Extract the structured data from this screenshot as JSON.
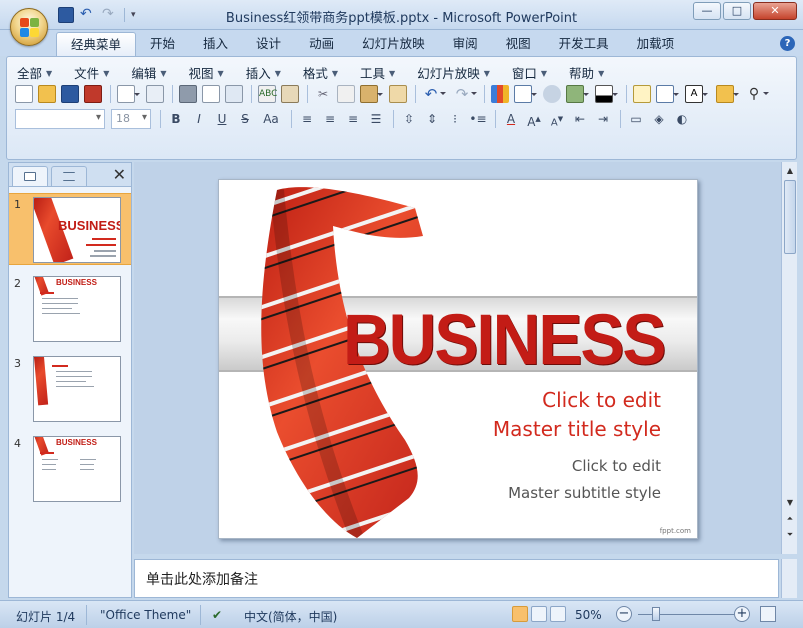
{
  "window": {
    "title": "Business红领带商务ppt模板.pptx - Microsoft PowerPoint",
    "controls": {
      "minimize": "—",
      "maximize": "□",
      "close": "✕"
    }
  },
  "ribbon_tabs": [
    "经典菜单",
    "开始",
    "插入",
    "设计",
    "动画",
    "幻灯片放映",
    "审阅",
    "视图",
    "开发工具",
    "加载项"
  ],
  "classic_menus": [
    "全部",
    "文件",
    "编辑",
    "视图",
    "插入",
    "格式",
    "工具",
    "幻灯片放映",
    "窗口",
    "帮助"
  ],
  "toolbar": {
    "font_name": "",
    "font_size": "18",
    "bold": "B",
    "italic": "I",
    "underline": "U",
    "strike": "S",
    "case": "Aa",
    "text_box": "A"
  },
  "slide_thumbnails": [
    {
      "number": "1",
      "selected": true
    },
    {
      "number": "2",
      "selected": false
    },
    {
      "number": "3",
      "selected": false
    },
    {
      "number": "4",
      "selected": false
    }
  ],
  "slide": {
    "banner_word": "BUSINESS",
    "title_line1": "Click to edit",
    "title_line2": "Master title style",
    "subtitle_line1": "Click to edit",
    "subtitle_line2": "Master subtitle style",
    "watermark": "fppt.com"
  },
  "notes": {
    "placeholder": "单击此处添加备注"
  },
  "status": {
    "slide_counter": "幻灯片 1/4",
    "theme": "\"Office Theme\"",
    "language": "中文(简体，中国)",
    "zoom": "50%"
  },
  "colors": {
    "accent_red": "#d22a1e",
    "ribbon_blue": "#c6d9ef",
    "selection_orange": "#f8c06c"
  }
}
